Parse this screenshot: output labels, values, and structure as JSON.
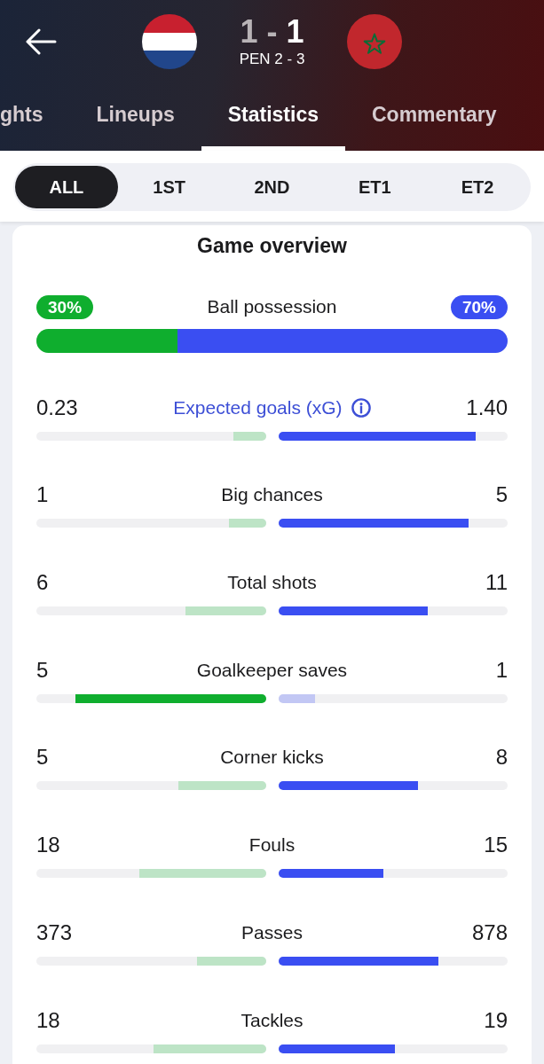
{
  "header": {
    "home_score": {
      "text": "1",
      "highlighted": false
    },
    "separator": "-",
    "away_score": {
      "text": "1",
      "highlighted": true
    },
    "penalties": "PEN 2 - 3"
  },
  "tabs": [
    {
      "label": "ghts",
      "selected": false
    },
    {
      "label": "Lineups",
      "selected": false
    },
    {
      "label": "Statistics",
      "selected": true
    },
    {
      "label": "Commentary",
      "selected": false
    }
  ],
  "periods": [
    {
      "label": "ALL",
      "selected": true
    },
    {
      "label": "1ST",
      "selected": false
    },
    {
      "label": "2ND",
      "selected": false
    },
    {
      "label": "ET1",
      "selected": false
    },
    {
      "label": "ET2",
      "selected": false
    }
  ],
  "overview": {
    "title": "Game overview",
    "possession": {
      "label": "Ball possession",
      "home": {
        "value": "30%",
        "level": 0.3
      },
      "away": {
        "value": "70%",
        "level": 0.7
      }
    },
    "stats": [
      {
        "label": "Expected goals (xG)",
        "info": true,
        "home": {
          "value": "0.23",
          "level": 0.14,
          "highlighted": false
        },
        "away": {
          "value": "1.40",
          "level": 0.86,
          "highlighted": true
        }
      },
      {
        "label": "Big chances",
        "info": false,
        "home": {
          "value": "1",
          "level": 0.16,
          "highlighted": false
        },
        "away": {
          "value": "5",
          "level": 0.83,
          "highlighted": true
        }
      },
      {
        "label": "Total shots",
        "info": false,
        "home": {
          "value": "6",
          "level": 0.35,
          "highlighted": false
        },
        "away": {
          "value": "11",
          "level": 0.65,
          "highlighted": true
        }
      },
      {
        "label": "Goalkeeper saves",
        "info": false,
        "home": {
          "value": "5",
          "level": 0.83,
          "highlighted": true
        },
        "away": {
          "value": "1",
          "level": 0.16,
          "highlighted": false
        }
      },
      {
        "label": "Corner kicks",
        "info": false,
        "home": {
          "value": "5",
          "level": 0.38,
          "highlighted": false
        },
        "away": {
          "value": "8",
          "level": 0.61,
          "highlighted": true
        }
      },
      {
        "label": "Fouls",
        "info": false,
        "home": {
          "value": "18",
          "level": 0.55,
          "highlighted": false
        },
        "away": {
          "value": "15",
          "level": 0.46,
          "highlighted": true
        }
      },
      {
        "label": "Passes",
        "info": false,
        "home": {
          "value": "373",
          "level": 0.3,
          "highlighted": false
        },
        "away": {
          "value": "878",
          "level": 0.7,
          "highlighted": true
        }
      },
      {
        "label": "Tackles",
        "info": false,
        "home": {
          "value": "18",
          "level": 0.49,
          "highlighted": false
        },
        "away": {
          "value": "19",
          "level": 0.51,
          "highlighted": true
        }
      }
    ]
  }
}
